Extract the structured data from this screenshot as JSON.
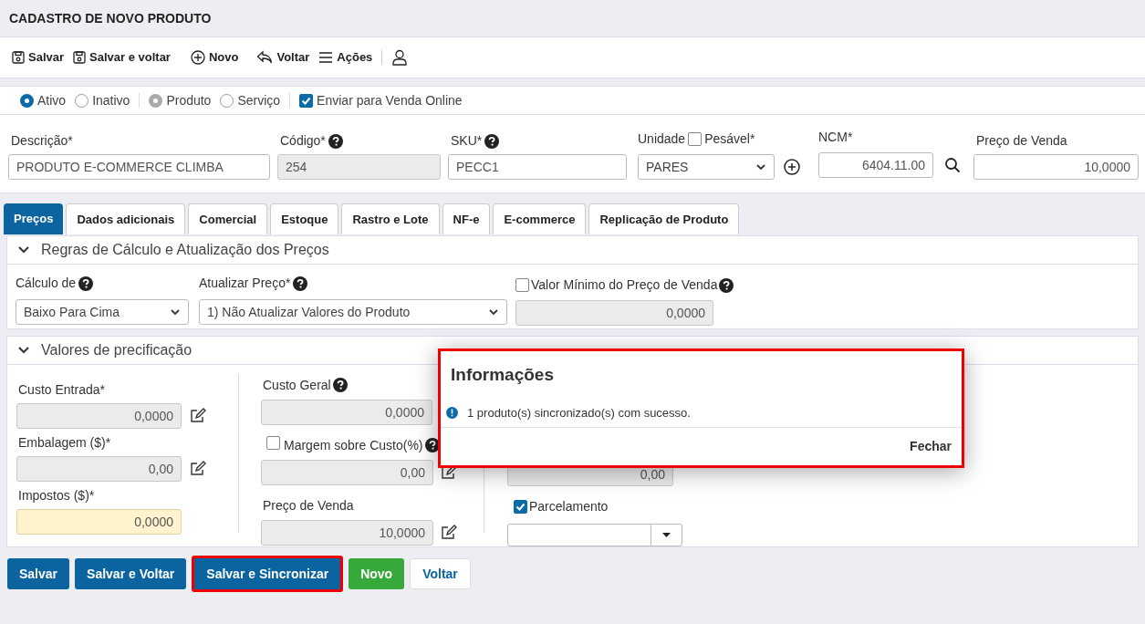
{
  "title": "CADASTRO DE NOVO PRODUTO",
  "toolbar": [
    {
      "label": "Salvar",
      "kind": "save"
    },
    {
      "label": "Salvar e voltar",
      "kind": "save"
    },
    {
      "label": "Novo",
      "kind": "new"
    },
    {
      "label": "Voltar",
      "kind": "back"
    },
    {
      "label": "Ações",
      "kind": "actions"
    }
  ],
  "radio_groups": [
    {
      "disabled": false,
      "options": [
        {
          "label": "Ativo",
          "selected": true
        },
        {
          "label": "Inativo",
          "selected": false
        }
      ]
    },
    {
      "disabled": true,
      "options": [
        {
          "label": "Produto",
          "selected": true
        },
        {
          "label": "Serviço",
          "selected": false
        }
      ]
    }
  ],
  "online_checkbox": {
    "label": "Enviar para Venda Online",
    "checked": true
  },
  "main_fields": [
    {
      "kind": "text",
      "label": "Descrição*",
      "value": "PRODUTO E-COMMERCE CLIMBA"
    },
    {
      "kind": "readonly",
      "label": "Código*",
      "value": "254",
      "help": true
    },
    {
      "kind": "text",
      "label": "SKU*",
      "value": "PECC1",
      "help": true
    },
    {
      "kind": "unit",
      "label": "Unidade",
      "check_label": "Pesável*",
      "checked": false,
      "value": "PARES"
    },
    {
      "kind": "ncm",
      "label": "NCM*",
      "value": "6404.11.00"
    },
    {
      "kind": "price",
      "label": "Preço de Venda",
      "value": "10,0000"
    }
  ],
  "tabs": [
    {
      "label": "Preços",
      "selected": true
    },
    {
      "label": "Dados adicionais",
      "selected": false
    },
    {
      "label": "Comercial",
      "selected": false
    },
    {
      "label": "Estoque",
      "selected": false
    },
    {
      "label": "Rastro e Lote",
      "selected": false
    },
    {
      "label": "NF-e",
      "selected": false
    },
    {
      "label": "E-commerce",
      "selected": false
    },
    {
      "label": "Replicação de Produto",
      "selected": false
    }
  ],
  "rules_section": {
    "title": "Regras de Cálculo e Atualização dos Preços",
    "expanded": true,
    "calc": {
      "label": "Cálculo de",
      "value": "Baixo Para Cima"
    },
    "update": {
      "label": "Atualizar Preço*",
      "value": "1) Não Atualizar Valores do Produto"
    },
    "minimum": {
      "label": "Valor Mínimo do Preço de Venda",
      "checked": false,
      "value": "0,0000"
    }
  },
  "values_section": {
    "title": "Valores de precificação",
    "expanded": true,
    "column_1": [
      {
        "label": "Custo Entrada*",
        "value": "0,0000",
        "edit": true
      },
      {
        "label": "Embalagem ($)*",
        "value": "0,00",
        "edit": true
      },
      {
        "label": "Impostos ($)*",
        "value": "0,0000",
        "highlighted": true
      }
    ],
    "column_2": [
      {
        "kind": "help",
        "label": "Custo Geral",
        "value": "0,0000"
      },
      {
        "kind": "check",
        "check_label": "Margem sobre Custo(%)",
        "checked": false,
        "value": "0,00",
        "edit": true
      },
      {
        "kind": "plain",
        "label": "Preço de Venda",
        "value": "10,0000",
        "edit": true
      }
    ],
    "column_3": {
      "value": "0,00",
      "installments": {
        "label": "Parcelamento",
        "checked": true
      }
    }
  },
  "footer_buttons": [
    {
      "label": "Salvar",
      "kind": "primary",
      "highlighted": false
    },
    {
      "label": "Salvar e Voltar",
      "kind": "primary",
      "highlighted": false
    },
    {
      "label": "Salvar e Sincronizar",
      "kind": "primary",
      "highlighted": true
    },
    {
      "label": "Novo",
      "kind": "success",
      "highlighted": false
    },
    {
      "label": "Voltar",
      "kind": "default",
      "highlighted": false
    }
  ],
  "dialog": {
    "title": "Informações",
    "message": "1 produto(s) sincronizado(s) com sucesso.",
    "button": "Fechar",
    "highlighted": true
  }
}
